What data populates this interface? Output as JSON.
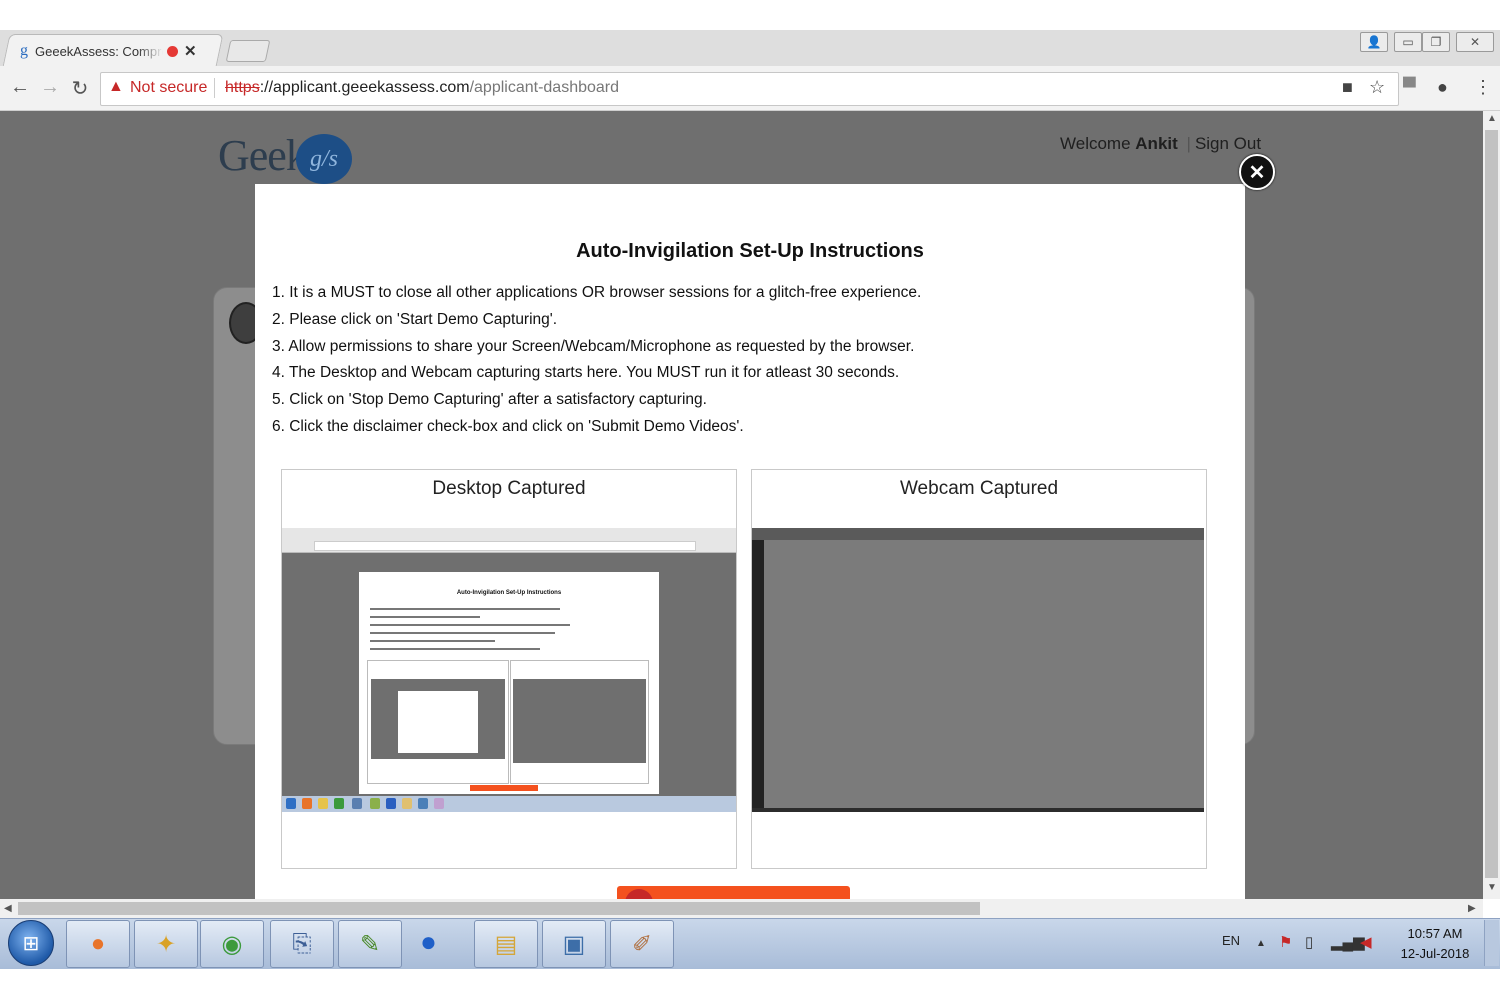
{
  "browser": {
    "tab_title": "GeeekAssess: Compre",
    "tab_favicon": "g",
    "not_secure_label": "Not secure",
    "url_scheme": "https",
    "url_host": "://applicant.geeekassess.com",
    "url_path": "/applicant-dashboard"
  },
  "header": {
    "logo_text": "Geek",
    "logo_badge": "g/s",
    "welcome_prefix": "Welcome",
    "user_name": "Ankit",
    "separator": "|",
    "sign_out": "Sign Out"
  },
  "modal": {
    "title": "Auto-Invigilation Set-Up Instructions",
    "instructions": [
      "1. It is a MUST to close all other applications OR browser sessions for a glitch-free experience.",
      "2. Please click on 'Start Demo Capturing'.",
      "3. Allow permissions to share your Screen/Webcam/Microphone as requested by the browser.",
      "4. The Desktop and Webcam capturing starts here. You MUST run it for atleast 30 seconds.",
      "5. Click on 'Stop Demo Capturing' after a satisfactory capturing.",
      "6. Click the disclaimer check-box and click on 'Submit Demo Videos'."
    ],
    "desktop_panel_title": "Desktop Captured",
    "webcam_panel_title": "Webcam Captured",
    "thumbnail_title": "Auto-Invigilation Set-Up Instructions"
  },
  "taskbar": {
    "language": "EN",
    "time": "10:57 AM",
    "date": "12-Jul-2018"
  },
  "colors": {
    "accent_orange": "#f4511e",
    "warning_red": "#c62828",
    "page_overlay": "#6f6f6f",
    "logo_blue": "#1d4e86"
  }
}
